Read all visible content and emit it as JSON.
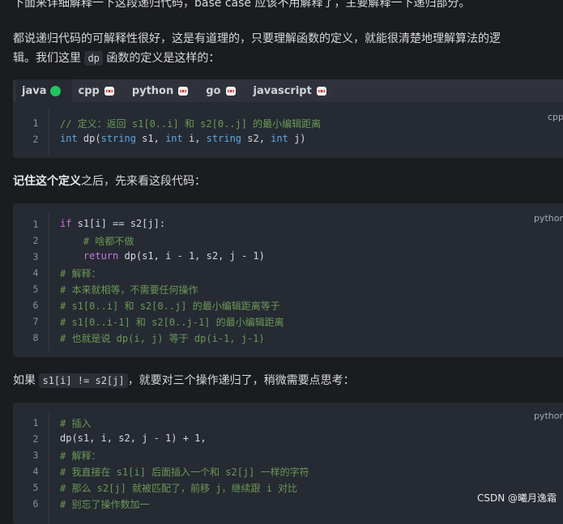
{
  "paragraphs": {
    "top": "下面来详细解释一下这段递归代码，base case 应该不用解释了，主要解释一下递归部分。",
    "p1_line1": "都说递归代码的可解释性很好，这是有道理的，只要理解函数的定义，就能很清楚地理解算法的逻",
    "p1_line2_a": "辑。我们这里",
    "p1_code": "dp",
    "p1_line2_b": "函数的定义是这样的：",
    "p2_bold": "记住这个定义",
    "p2_rest": "之后，先来看这段代码：",
    "p3_a": "如果",
    "p3_code": "s1[i] != s2[j]",
    "p3_b": "，就要对三个操作递归了，稍微需要点思考："
  },
  "block1": {
    "tabs": [
      {
        "label": "java",
        "icon": "green-dot-icon"
      },
      {
        "label": "cpp",
        "icon": "robot-icon"
      },
      {
        "label": "python",
        "icon": "robot-icon"
      },
      {
        "label": "go",
        "icon": "robot-icon"
      },
      {
        "label": "javascript",
        "icon": "robot-icon"
      }
    ],
    "lang": "cpp",
    "line_numbers": [
      "1",
      "2"
    ],
    "lines": [
      "// 定义：返回 s1[0..i] 和 s2[0..j] 的最小编辑距离",
      "int dp(string s1, int i, string s2, int j)"
    ]
  },
  "block2": {
    "lang": "python",
    "line_numbers": [
      "1",
      "2",
      "3",
      "4",
      "5",
      "6",
      "7",
      "8"
    ],
    "lines": [
      "if s1[i] == s2[j]:",
      "    # 啥都不做",
      "    return dp(s1, i - 1, s2, j - 1)",
      "# 解释：",
      "# 本来就相等，不需要任何操作",
      "# s1[0..i] 和 s2[0..j] 的最小编辑距离等于",
      "# s1[0..i-1] 和 s2[0..j-1] 的最小编辑距离",
      "# 也就是说 dp(i, j) 等于 dp(i-1, j-1)"
    ]
  },
  "block3": {
    "lang": "python",
    "line_numbers": [
      "1",
      "2",
      "3",
      "4",
      "5",
      "6"
    ],
    "lines": [
      "# 插入",
      "dp(s1, i, s2, j - 1) + 1,",
      "# 解释：",
      "# 我直接在 s1[i] 后面插入一个和 s2[j] 一样的字符",
      "# 那么 s2[j] 就被匹配了，前移 j，继续跟 i 对比",
      "# 别忘了操作数加一"
    ]
  },
  "footer": "CSDN @曦月逸霜",
  "colors": {
    "active_dot": "#22c55e",
    "comment": "#6a9955",
    "keyword": "#c678dd",
    "type": "#5fa8e0"
  }
}
